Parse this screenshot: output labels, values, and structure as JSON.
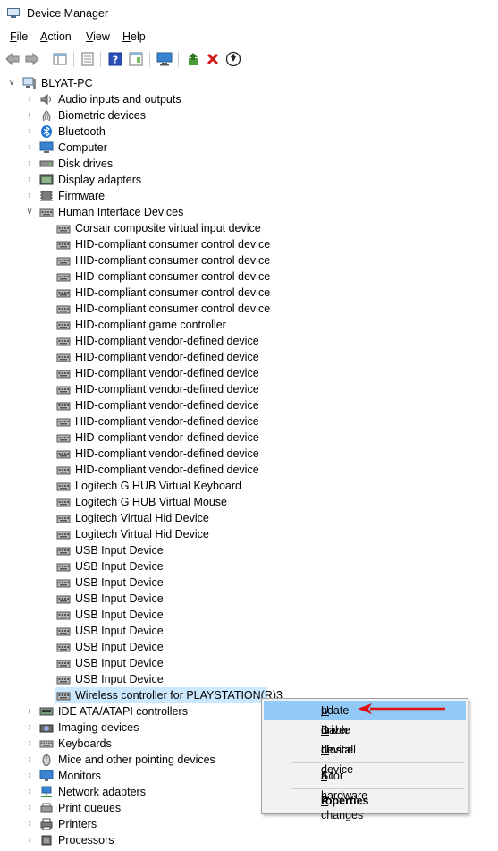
{
  "window": {
    "title": "Device Manager"
  },
  "menu": [
    {
      "label": "File",
      "mnemonic": "F",
      "rest": "ile"
    },
    {
      "label": "Action",
      "mnemonic": "A",
      "rest": "ction"
    },
    {
      "label": "View",
      "mnemonic": "V",
      "rest": "iew"
    },
    {
      "label": "Help",
      "mnemonic": "H",
      "rest": "elp"
    }
  ],
  "toolbar": [
    "back-icon",
    "forward-icon",
    "show-hide-tree-icon",
    "properties-icon",
    "help-icon",
    "action-pane-icon",
    "monitor-icon",
    "add-driver-icon",
    "uninstall-icon",
    "update-driver-icon"
  ],
  "tree": {
    "root": "BLYAT-PC",
    "categories_before": [
      "Audio inputs and outputs",
      "Biometric devices",
      "Bluetooth",
      "Computer",
      "Disk drives",
      "Display adapters",
      "Firmware"
    ],
    "expanded_category": "Human Interface Devices",
    "hid_devices": [
      "Corsair composite virtual input device",
      "HID-compliant consumer control device",
      "HID-compliant consumer control device",
      "HID-compliant consumer control device",
      "HID-compliant consumer control device",
      "HID-compliant consumer control device",
      "HID-compliant game controller",
      "HID-compliant vendor-defined device",
      "HID-compliant vendor-defined device",
      "HID-compliant vendor-defined device",
      "HID-compliant vendor-defined device",
      "HID-compliant vendor-defined device",
      "HID-compliant vendor-defined device",
      "HID-compliant vendor-defined device",
      "HID-compliant vendor-defined device",
      "HID-compliant vendor-defined device",
      "Logitech G HUB Virtual Keyboard",
      "Logitech G HUB Virtual Mouse",
      "Logitech Virtual Hid Device",
      "Logitech Virtual Hid Device",
      "USB Input Device",
      "USB Input Device",
      "USB Input Device",
      "USB Input Device",
      "USB Input Device",
      "USB Input Device",
      "USB Input Device",
      "USB Input Device",
      "USB Input Device",
      "Wireless controller for PLAYSTATION(R)3"
    ],
    "categories_after": [
      "IDE ATA/ATAPI controllers",
      "Imaging devices",
      "Keyboards",
      "Mice and other pointing devices",
      "Monitors",
      "Network adapters",
      "Print queues",
      "Printers",
      "Processors"
    ]
  },
  "context_menu": {
    "items": [
      {
        "label": "Update driver",
        "mnemonic": "U",
        "rest": "pdate driver",
        "highlighted": true
      },
      {
        "label": "Disable device",
        "mnemonic": "D",
        "rest": "isable device"
      },
      {
        "label": "Uninstall device",
        "mnemonic": "U",
        "rest": "ninstall device"
      },
      {
        "label": "Scan for hardware changes",
        "pre": "Sc",
        "mnemonic": "a",
        "rest": "n for hardware changes"
      },
      {
        "label": "Properties",
        "mnemonic": "P",
        "rest": "roperties",
        "bold": true
      }
    ]
  },
  "colors": {
    "selection": "#cce8ff",
    "menu_highlight": "#91c9f7",
    "annotation_arrow": "#e01010"
  }
}
